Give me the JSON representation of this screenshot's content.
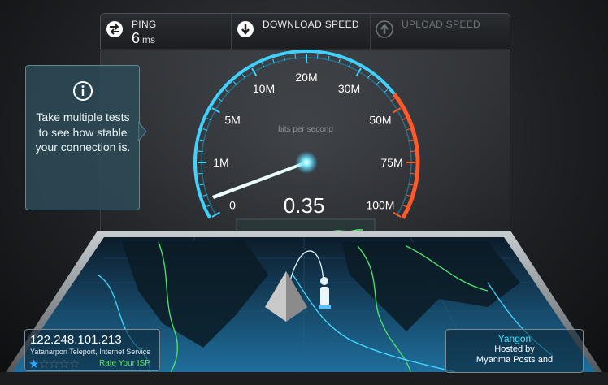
{
  "top_bar": {
    "ping": {
      "label": "PING",
      "value": "6",
      "unit": "ms",
      "icon": "ping-arrows-icon"
    },
    "download": {
      "label": "DOWNLOAD SPEED",
      "icon": "download-arrow-icon"
    },
    "upload": {
      "label": "UPLOAD SPEED",
      "icon": "upload-arrow-icon"
    }
  },
  "tip": {
    "icon": "info-icon",
    "text": "Take multiple tests to see how stable your connection is."
  },
  "gauge": {
    "ticks": [
      "0",
      "1M",
      "5M",
      "10M",
      "20M",
      "30M",
      "50M",
      "75M",
      "100M"
    ],
    "unit_label": "bits per second",
    "reading": "0.35",
    "accent_color": "#3fd1ff",
    "danger_color": "#ff5a2a"
  },
  "client": {
    "ip": "122.248.101.213",
    "isp": "Yatanarpon Teleport, Internet Service",
    "rating": 1,
    "rating_max": 5,
    "rate_label": "Rate Your ISP"
  },
  "server": {
    "city": "Yangon",
    "hosted_label": "Hosted by",
    "host": "Myanma Posts and"
  }
}
